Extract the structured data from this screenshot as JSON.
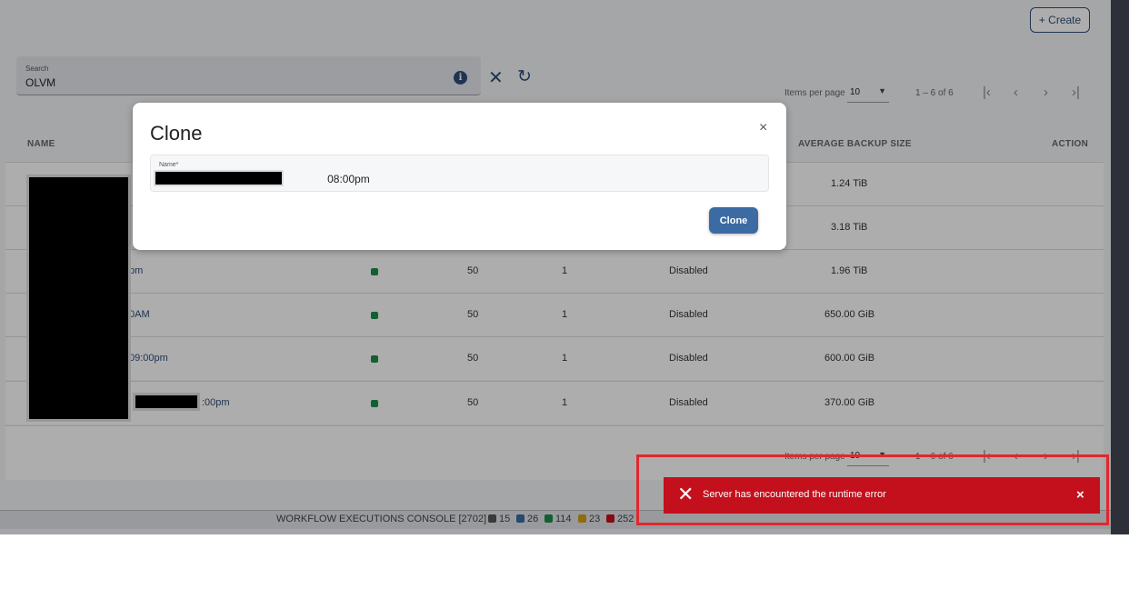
{
  "toolbar": {
    "create_label": "+ Create"
  },
  "search": {
    "label": "Search",
    "value": "OLVM"
  },
  "pager": {
    "items_per_page_label": "Items per page",
    "page_size": "10",
    "range": "1 – 6 of 6",
    "first": "|<",
    "prev": "<",
    "next": ">",
    "last": ">|"
  },
  "table": {
    "headers": {
      "name": "NAME",
      "avg_backup_size": "AVERAGE BACKUP SIZE",
      "action": "ACTION"
    },
    "rows": [
      {
        "name": "",
        "col1": "",
        "col2": "",
        "status": "",
        "size": "1.24 TiB"
      },
      {
        "name": "",
        "col1": "",
        "col2": "",
        "status": "",
        "size": "3.18 TiB"
      },
      {
        "name": "pm",
        "col1": "50",
        "col2": "1",
        "status": "Disabled",
        "size": "1.96 TiB"
      },
      {
        "name": "0AM",
        "col1": "50",
        "col2": "1",
        "status": "Disabled",
        "size": "650.00 GiB"
      },
      {
        "name": "09:00pm",
        "col1": "50",
        "col2": "1",
        "status": "Disabled",
        "size": "600.00 GiB"
      },
      {
        "name": ":00pm",
        "col1": "50",
        "col2": "1",
        "status": "Disabled",
        "size": "370.00 GiB"
      }
    ],
    "status_color": "#1b8c4a"
  },
  "statusbar": {
    "title": "WORKFLOW EXECUTIONS CONSOLE [2702]",
    "counts": [
      {
        "value": "15",
        "color": "#555555"
      },
      {
        "value": "26",
        "color": "#3c6aa3"
      },
      {
        "value": "114",
        "color": "#1b8c4a"
      },
      {
        "value": "23",
        "color": "#d4a017"
      },
      {
        "value": "252",
        "color": "#c4101c"
      }
    ]
  },
  "modal": {
    "title": "Clone",
    "close": "×",
    "name_label": "Name*",
    "name_value_visible": "08:00pm",
    "clone_label": "Clone"
  },
  "toast": {
    "icon": "close-x",
    "message": "Server has encountered the runtime error",
    "close": "×",
    "color": "#c4101c"
  },
  "colors": {
    "accent": "#2f4d7a",
    "primary_button": "#3c6aa3",
    "error": "#c4101c"
  }
}
